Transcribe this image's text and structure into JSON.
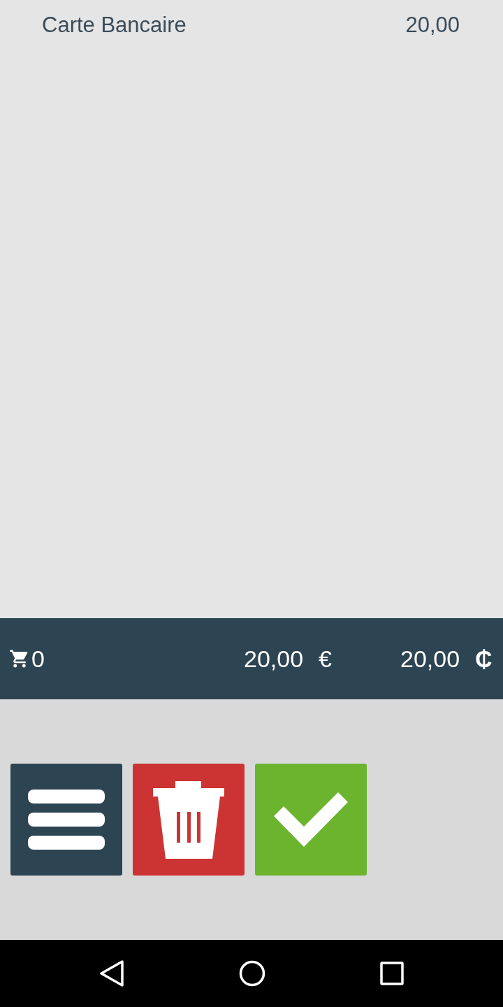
{
  "payments": [
    {
      "method": "Carte Bancaire",
      "amount": "20,00"
    }
  ],
  "summary": {
    "item_count": "0",
    "total": "20,00",
    "total_currency": "€",
    "paid": "20,00",
    "paid_currency": "₵"
  },
  "actions": [
    {
      "kind": "menu"
    },
    {
      "kind": "delete"
    },
    {
      "kind": "confirm"
    }
  ]
}
